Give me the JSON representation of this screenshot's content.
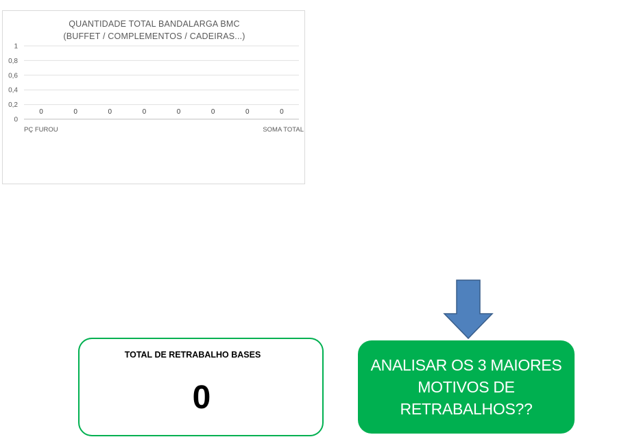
{
  "chart_data": {
    "type": "line",
    "title": "QUANTIDADE TOTAL BANDALARGA BMC",
    "subtitle": "(BUFFET / COMPLEMENTOS  / CADEIRAS...)",
    "categories": [
      "PÇ FUROU",
      "",
      "",
      "",
      "",
      "",
      "",
      "SOMA TOTAL"
    ],
    "values": [
      0,
      0,
      0,
      0,
      0,
      0,
      0,
      0
    ],
    "y_ticks": [
      "1",
      "0,8",
      "0,6",
      "0,4",
      "0,2",
      "0"
    ],
    "ylim": [
      0,
      1
    ],
    "grid": true,
    "legend": "none"
  },
  "total_card": {
    "label": "TOTAL DE RETRABALHO BASES",
    "value": "0"
  },
  "analyze_card": {
    "text": "ANALISAR OS 3 MAIORES MOTIVOS DE RETRABALHOS??"
  },
  "colors": {
    "green": "#00b050",
    "arrow_fill": "#4f81bd",
    "arrow_stroke": "#385d8a"
  },
  "icons": {
    "arrow": "arrow-down-icon"
  }
}
